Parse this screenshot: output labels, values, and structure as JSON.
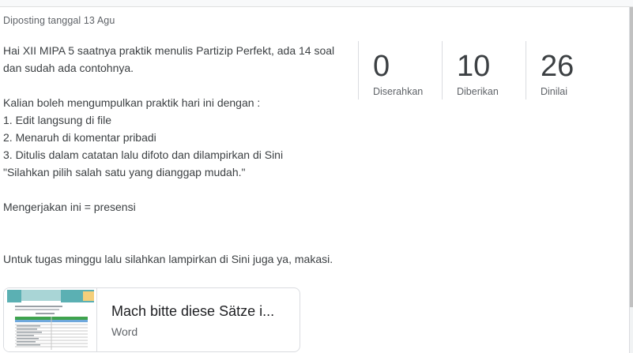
{
  "posted_date": "Diposting tanggal 13 Agu",
  "description_lines": [
    "Hai XII MIPA 5 saatnya praktik menulis Partizip Perfekt, ada 14 soal",
    "dan sudah ada contohnya.",
    "",
    "Kalian boleh mengumpulkan praktik hari ini dengan :",
    "1. Edit langsung di file",
    "2. Menaruh di komentar pribadi",
    "3. Ditulis dalam catatan lalu difoto dan dilampirkan di Sini",
    "\"Silahkan pilih salah satu yang dianggap mudah.\"",
    "",
    "Mengerjakan ini = presensi",
    "",
    "",
    "Untuk tugas minggu lalu silahkan lampirkan di Sini juga ya, makasi."
  ],
  "stats": [
    {
      "value": "0",
      "label": "Diserahkan"
    },
    {
      "value": "10",
      "label": "Diberikan"
    },
    {
      "value": "26",
      "label": "Dinilai"
    }
  ],
  "attachment": {
    "title": "Mach bitte diese Sätze i...",
    "type": "Word",
    "thumbnail_icon": "document-thumbnail-icon"
  },
  "colors": {
    "text_primary": "#3c4043",
    "text_secondary": "#5f6368",
    "divider": "#dadce0",
    "thumb_teal": "#5bb0b3",
    "thumb_yellow": "#f4cf7a"
  }
}
